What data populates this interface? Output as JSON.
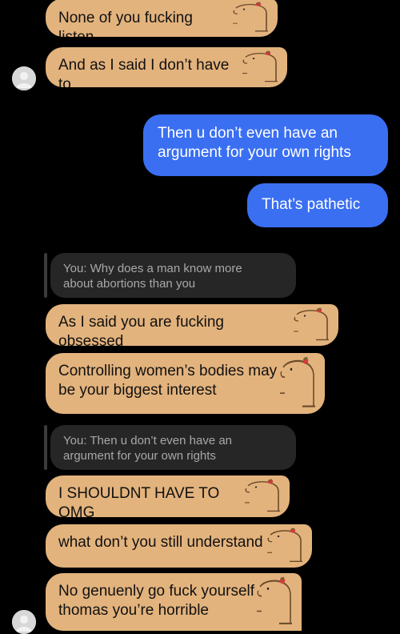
{
  "colors": {
    "background": "#000000",
    "incoming_bubble": "#e3b37d",
    "outgoing_bubble": "#3a6ff2",
    "reply_preview": "#262626"
  },
  "messages": {
    "m1": "None of you fucking listen",
    "m2": "And as I said I don’t have to",
    "o1_line1": "Then u don’t even have an",
    "o1_line2": "argument for your own rights",
    "o2": "That’s pathetic",
    "r1_line1": "You: Why does a man know more",
    "r1_line2": "about abortions than you",
    "m3": "As I said you are fucking obsessed",
    "m4_line1": "Controlling women’s bodies may",
    "m4_line2": "be your biggest interest",
    "r2_line1": "You: Then u don’t even have an",
    "r2_line2": "argument for your own rights",
    "m5": "I SHOULDNT HAVE TO OMG",
    "m6": "what don’t you still understand",
    "m7_line1": "No genuenly go fuck yourself",
    "m7_line2": "thomas you’re horrible"
  },
  "icons": {
    "avatar": "default-user-avatar-icon",
    "bubble_decoration": "capybara-sticker-icon"
  }
}
